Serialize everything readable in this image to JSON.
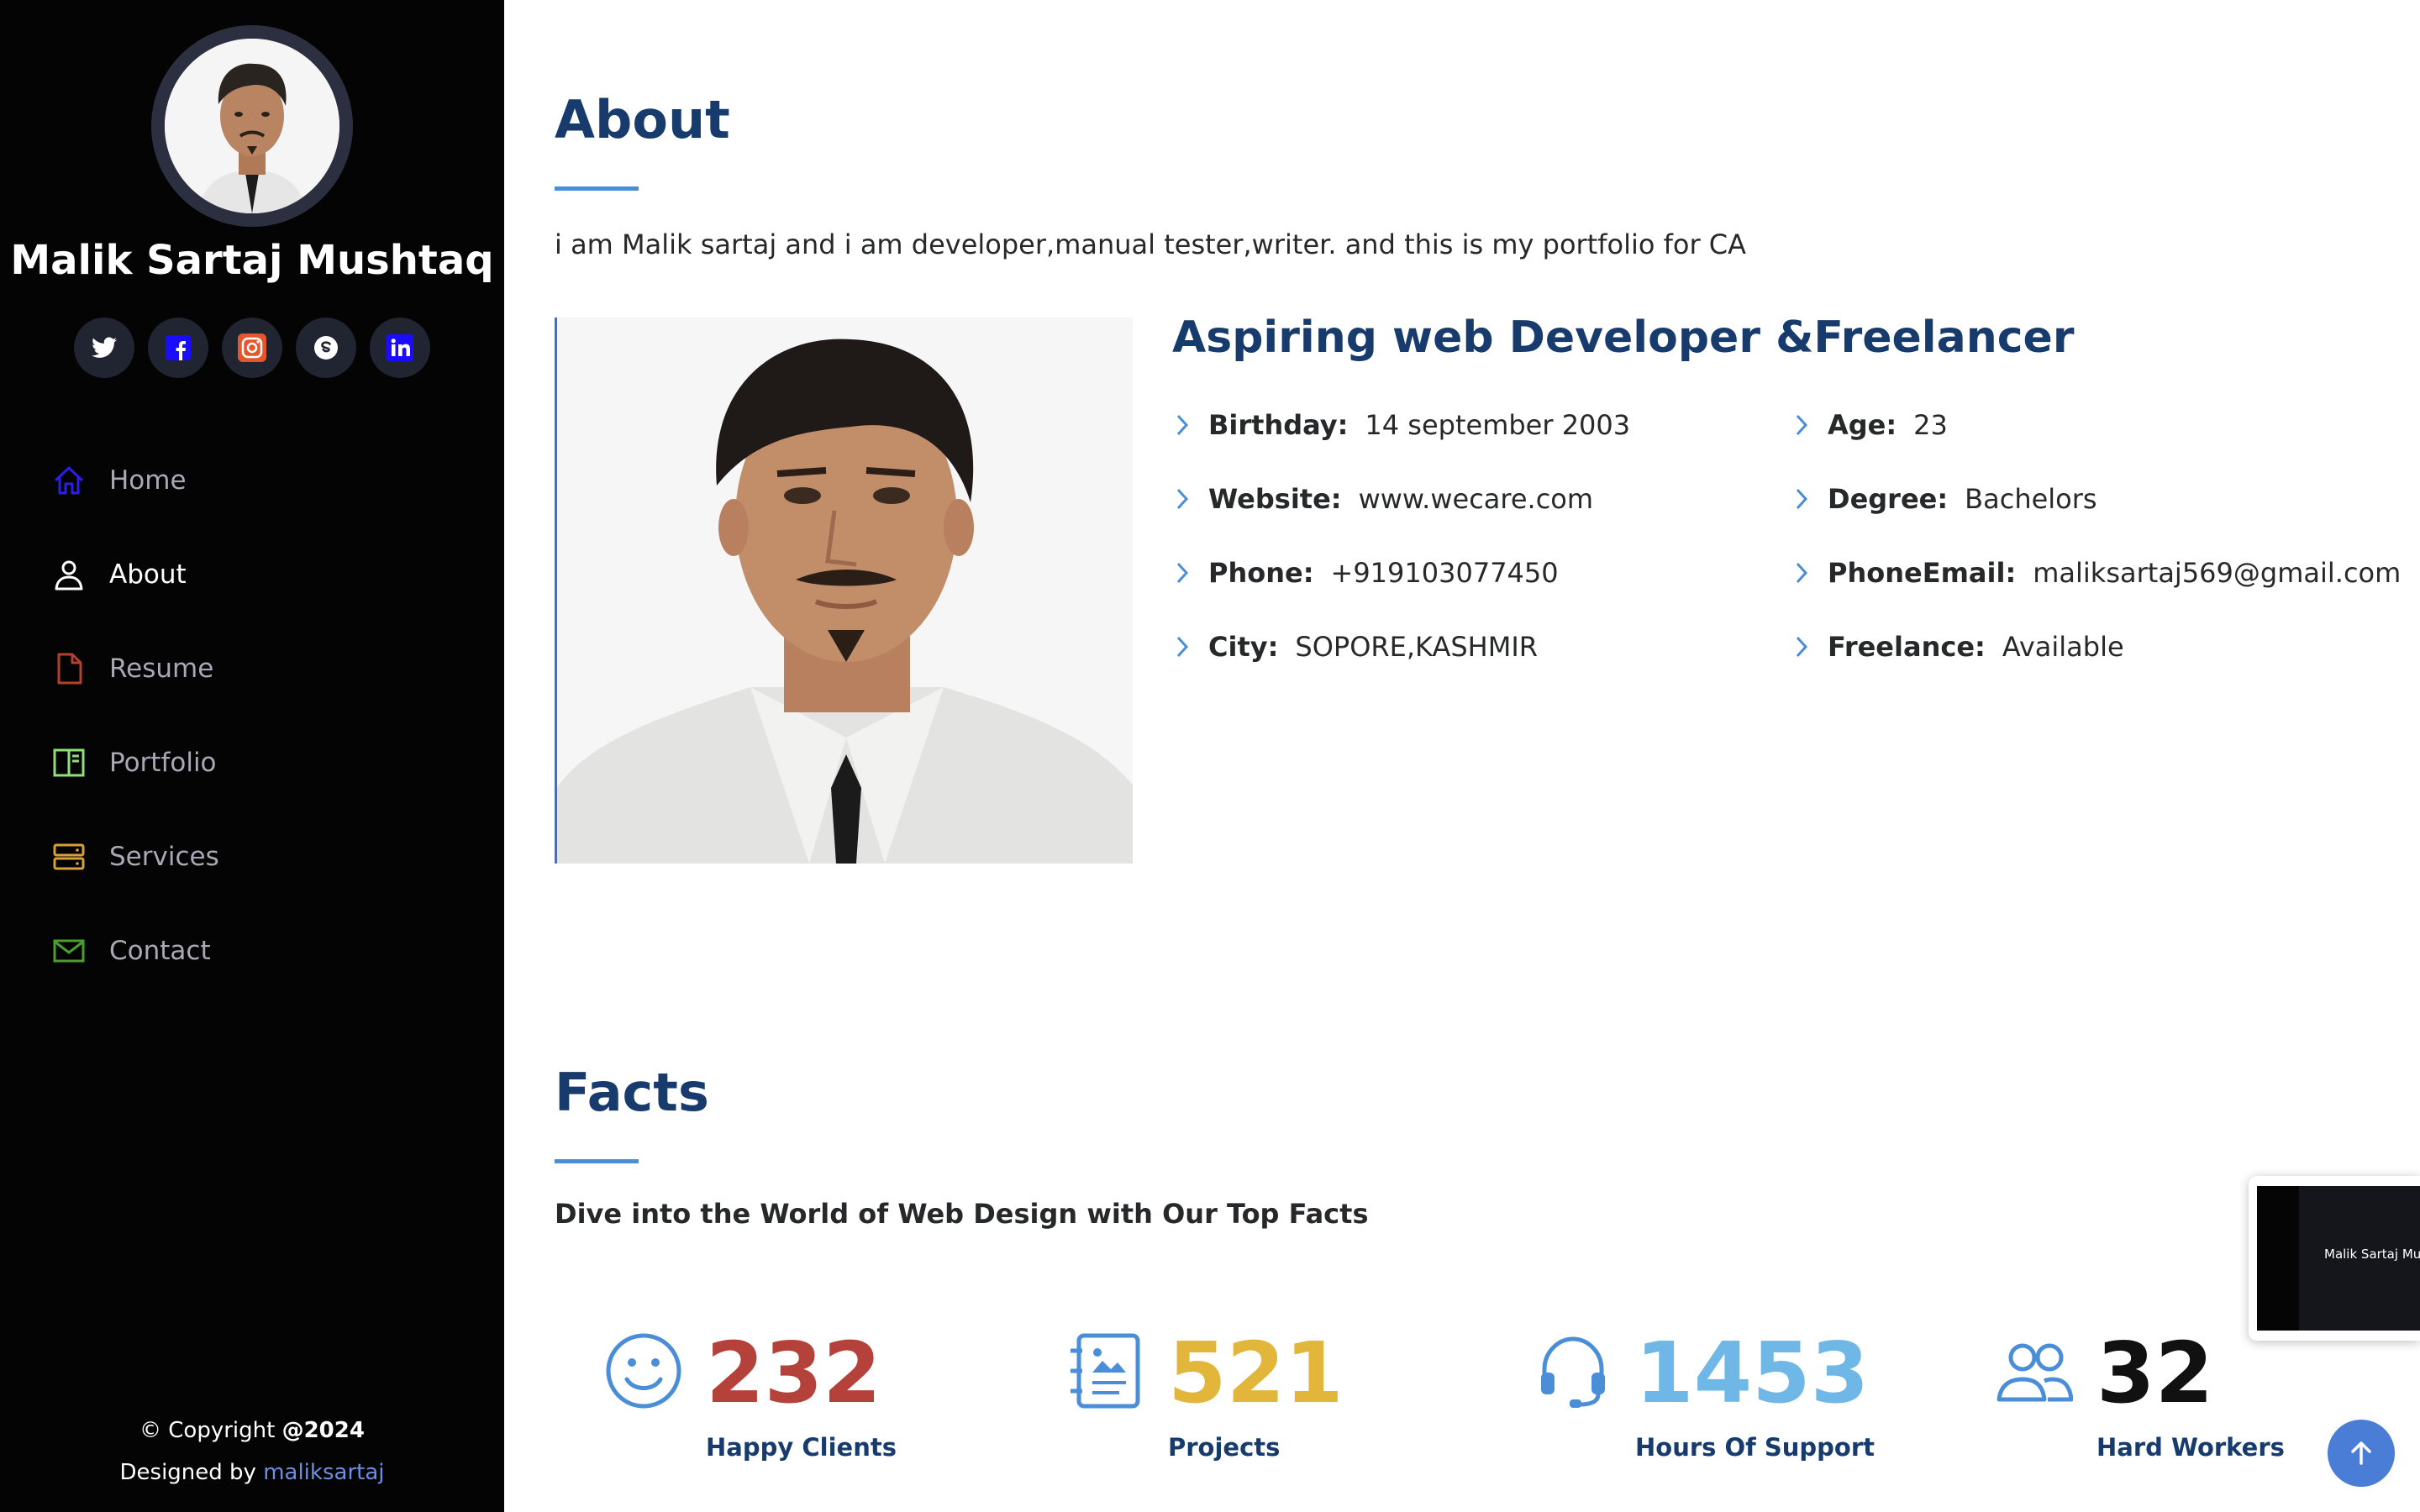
{
  "sidebar": {
    "profile_name": "Malik Sartaj Mushtaq",
    "social": [
      {
        "name": "twitter-icon",
        "color": "#ffffff"
      },
      {
        "name": "facebook-icon",
        "color": "#1a0dff"
      },
      {
        "name": "instagram-icon",
        "color": "#e4572e"
      },
      {
        "name": "skype-icon",
        "color": "#ffffff"
      },
      {
        "name": "linkedin-icon",
        "color": "#1a0dff"
      }
    ],
    "nav": [
      {
        "label": "Home",
        "icon": "house-icon",
        "color": "#2a1ee8"
      },
      {
        "label": "About",
        "icon": "person-icon",
        "color": "#ffffff"
      },
      {
        "label": "Resume",
        "icon": "file-icon",
        "color": "#b4412f"
      },
      {
        "label": "Portfolio",
        "icon": "book-half-icon",
        "color": "#8fe07a"
      },
      {
        "label": "Services",
        "icon": "server-icon",
        "color": "#d6a13a"
      },
      {
        "label": "Contact",
        "icon": "envelope-icon",
        "color": "#4a9e2f"
      }
    ],
    "active": "About",
    "copyright_prefix": "© Copyright",
    "copyright_year": "@2024",
    "designed_by_prefix": "Designed by",
    "designed_by_link": "maliksartaj"
  },
  "about": {
    "title": "About",
    "intro": "i am Malik sartaj and i am developer,manual tester,writer. and this is my portfolio for CA",
    "heading": "Aspiring web Developer &Freelancer",
    "left_info": [
      {
        "label": "Birthday:",
        "value": "14 september 2003"
      },
      {
        "label": "Website:",
        "value": "www.wecare.com"
      },
      {
        "label": "Phone:",
        "value": "+919103077450"
      },
      {
        "label": "City:",
        "value": "SOPORE,KASHMIR"
      }
    ],
    "right_info": [
      {
        "label": "Age:",
        "value": "23"
      },
      {
        "label": "Degree:",
        "value": "Bachelors"
      },
      {
        "label": "PhoneEmail:",
        "value": "maliksartaj569@gmail.com"
      },
      {
        "label": "Freelance:",
        "value": "Available"
      }
    ]
  },
  "facts": {
    "title": "Facts",
    "subtitle": "Dive into the World of Web Design with Our Top Facts",
    "items": [
      {
        "number": "232",
        "label": "Happy Clients",
        "icon": "emoji-smile-icon",
        "color": "#b5423a"
      },
      {
        "number": "521",
        "label": "Projects",
        "icon": "journal-richtext-icon",
        "color": "#e2b63b"
      },
      {
        "number": "1453",
        "label": "Hours Of Support",
        "icon": "headset-icon",
        "color": "#6fb7e6"
      },
      {
        "number": "32",
        "label": "Hard Workers",
        "icon": "people-icon",
        "color": "#111111"
      }
    ]
  },
  "thumbnail": {
    "title": "Malik Sartaj Mushtaq"
  },
  "colors": {
    "accent": "#4a8ed8",
    "heading": "#173b6c",
    "sidebar_bg": "#040404"
  }
}
